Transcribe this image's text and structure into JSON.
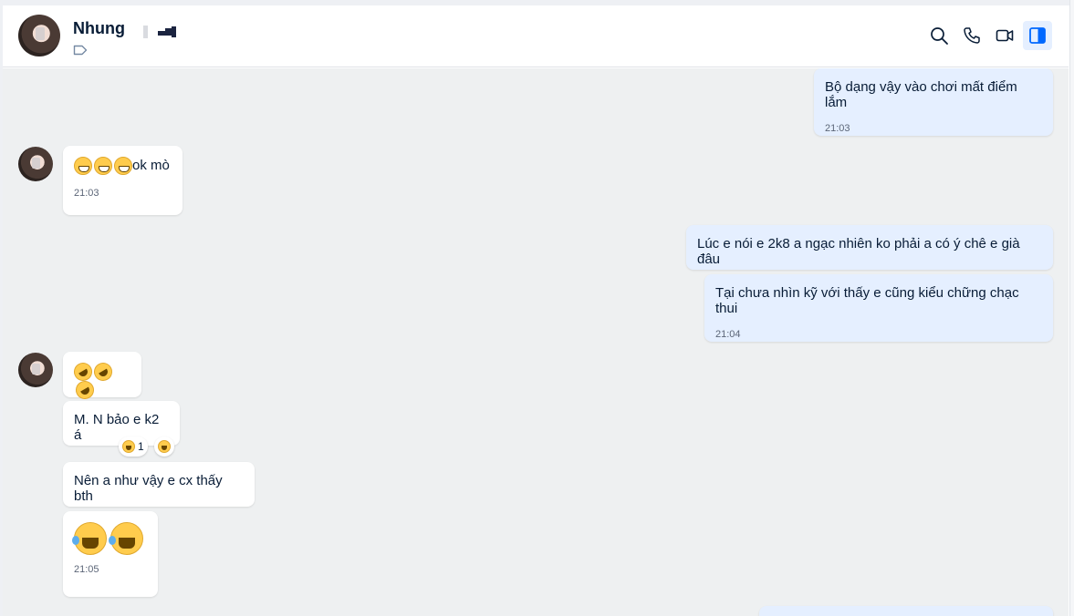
{
  "header": {
    "contact_name": "Nhung",
    "icons": [
      "tag-icon",
      "search-icon",
      "phone-icon",
      "video-icon",
      "sidebar-toggle-icon"
    ]
  },
  "messages": [
    {
      "side": "sent",
      "text": "Bộ dạng vậy vào chơi mất điểm lắm",
      "time": "21:03"
    },
    {
      "side": "received",
      "emojis": [
        "grin",
        "grin",
        "grin"
      ],
      "text": "ok mò",
      "time": "21:03"
    },
    {
      "side": "sent",
      "text": "Lúc e nói e 2k8 a ngạc nhiên ko phải a có ý chê e già đâu"
    },
    {
      "side": "sent",
      "text": "Tại chưa nhìn kỹ với thấy e cũng kiểu chững chạc thui",
      "time": "21:04"
    },
    {
      "side": "received",
      "emojis": [
        "rofl",
        "rofl",
        "rofl"
      ]
    },
    {
      "side": "received",
      "text": "M. N bảo e k2 á",
      "reaction": {
        "emoji": "laughing",
        "count": "1"
      }
    },
    {
      "side": "received",
      "text": "Nên a như vậy e cx thấy bth"
    },
    {
      "side": "received",
      "emojis": [
        "joy",
        "joy"
      ],
      "time": "21:05"
    }
  ],
  "colors": {
    "sent_bubble": "#e5efff",
    "received_bubble": "#ffffff",
    "chat_background": "#eef0f1",
    "accent": "#0068ff"
  }
}
